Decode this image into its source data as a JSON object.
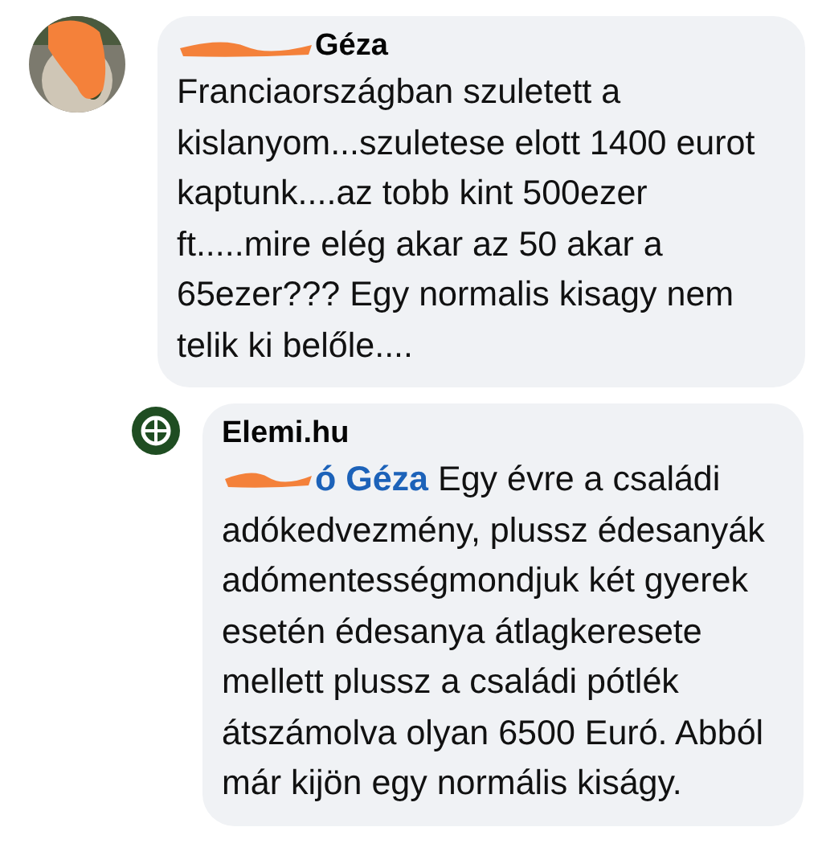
{
  "comments": [
    {
      "author": "Géza",
      "author_redacted": true,
      "avatar": {
        "kind": "picture",
        "redacted": true
      },
      "text": "Franciaországban szuletett a kislanyom...szuletese elott 1400 eurot kaptunk....az tobb kint 500ezer ft.....mire elég akar az 50 akar a 65ezer??? Egy normalis kisagy nem telik ki belőle....",
      "replies": [
        {
          "author": "Elemi.hu",
          "avatar": {
            "kind": "logo"
          },
          "mention": "ó Géza",
          "mention_redacted": true,
          "text": "Egy évre a családi adókedvezmény, plussz édesanyák adómentességmondjuk két gyerek esetén édesanya átlagkeresete mellett plussz a családi pótlék átszámolva olyan 6500 Euró. Abból már kijön egy normális kiságy."
        }
      ]
    }
  ]
}
